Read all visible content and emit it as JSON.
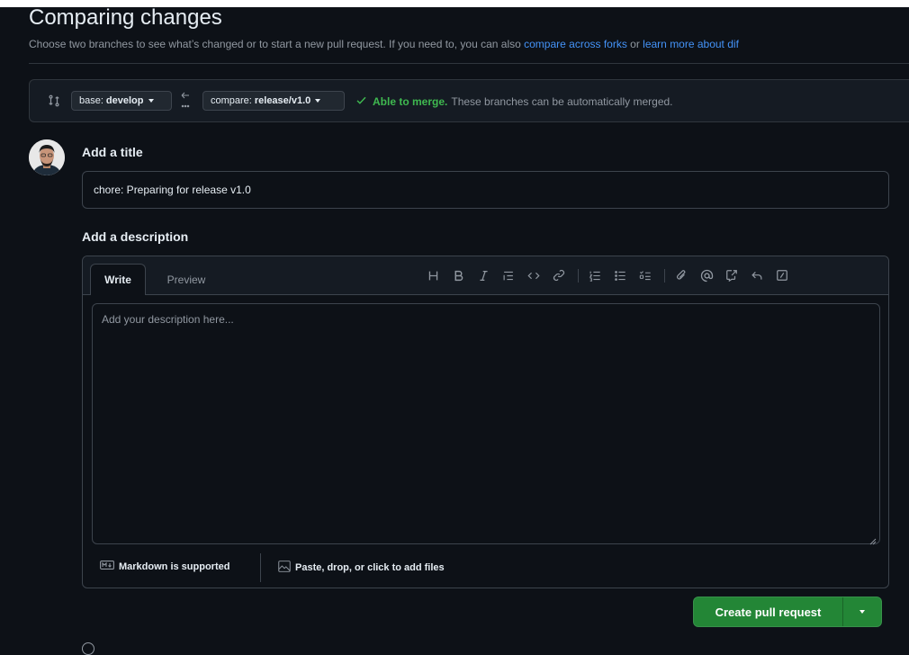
{
  "header": {
    "title": "Comparing changes",
    "subtitle_prefix": "Choose two branches to see what’s changed or to start a new pull request. If you need to, you can also ",
    "link_forks": "compare across forks",
    "subtitle_mid": " or ",
    "link_learn": "learn more about dif"
  },
  "range": {
    "base_prefix": "base:",
    "base_branch": "develop",
    "compare_prefix": "compare:",
    "compare_branch": "release/v1.0",
    "merge_ok": "Able to merge.",
    "merge_text": "These branches can be automatically merged."
  },
  "form": {
    "title_label": "Add a title",
    "title_value": "chore: Preparing for release v1.0",
    "description_label": "Add a description",
    "tabs": [
      "Write",
      "Preview"
    ],
    "description_placeholder": "Add your description here...",
    "markdown_note": "Markdown is supported",
    "attach_note": "Paste, drop, or click to add files",
    "toolbar_icons": [
      "heading-icon",
      "bold-icon",
      "italic-icon",
      "quote-icon",
      "code-icon",
      "link-icon",
      "ordered-list-icon",
      "unordered-list-icon",
      "task-list-icon",
      "attach-icon",
      "mention-icon",
      "reference-icon",
      "reply-icon",
      "slash-commands-icon"
    ]
  },
  "actions": {
    "create_label": "Create pull request"
  },
  "colors": {
    "background": "#0d1117",
    "accent_link": "#4493f8",
    "success": "#3fb950",
    "button_green": "#238636"
  }
}
